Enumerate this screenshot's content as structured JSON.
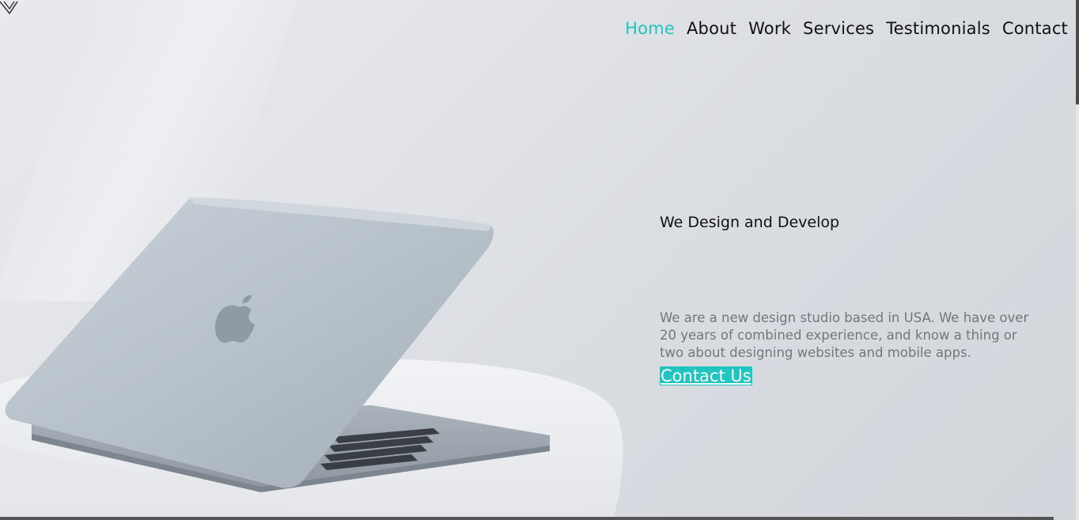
{
  "brand": {
    "logo_icon": "v-chevron-logo-icon"
  },
  "nav": {
    "items": [
      {
        "label": "Home",
        "active": true
      },
      {
        "label": "About"
      },
      {
        "label": "Work"
      },
      {
        "label": "Services"
      },
      {
        "label": "Testimonials"
      },
      {
        "label": "Contact"
      }
    ]
  },
  "hero": {
    "heading": "We Design and Develop",
    "description": "We are a new design studio based in USA. We have over 20 years of combined experience, and know a thing or two about designing websites and mobile apps.",
    "cta_label": "Contact Us",
    "image_icon": "laptop-on-chair-image"
  },
  "colors": {
    "accent": "#20c4c0",
    "text": "#111111",
    "muted_text": "#767676"
  }
}
